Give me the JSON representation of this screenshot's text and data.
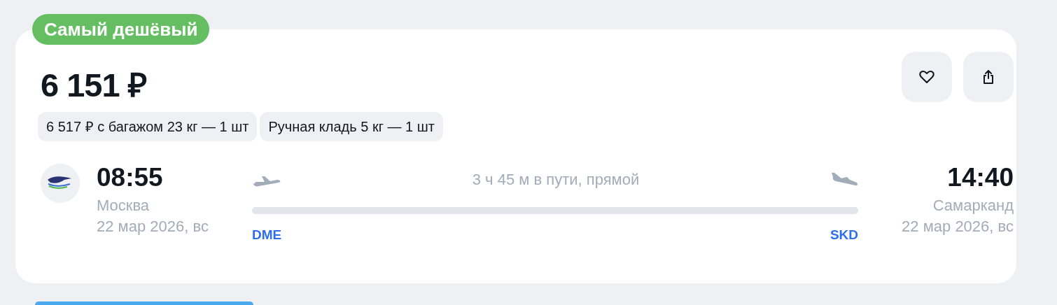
{
  "badge": {
    "label": "Самый дешёвый",
    "color": "#66be63"
  },
  "price": "6 151 ₽",
  "actions": [
    {
      "kind": "favorite"
    },
    {
      "kind": "share"
    }
  ],
  "chips": [
    "6 517 ₽ с багажом 23 кг — 1 шт",
    "Ручная кладь 5 кг — 1 шт"
  ],
  "departure": {
    "time": "08:55",
    "city": "Москва",
    "date": "22 мар 2026, вс",
    "code": "DME"
  },
  "duration": "3 ч 45 м в пути, прямой",
  "arrival": {
    "time": "14:40",
    "city": "Самарканд",
    "date": "22 мар 2026, вс",
    "code": "SKD"
  }
}
